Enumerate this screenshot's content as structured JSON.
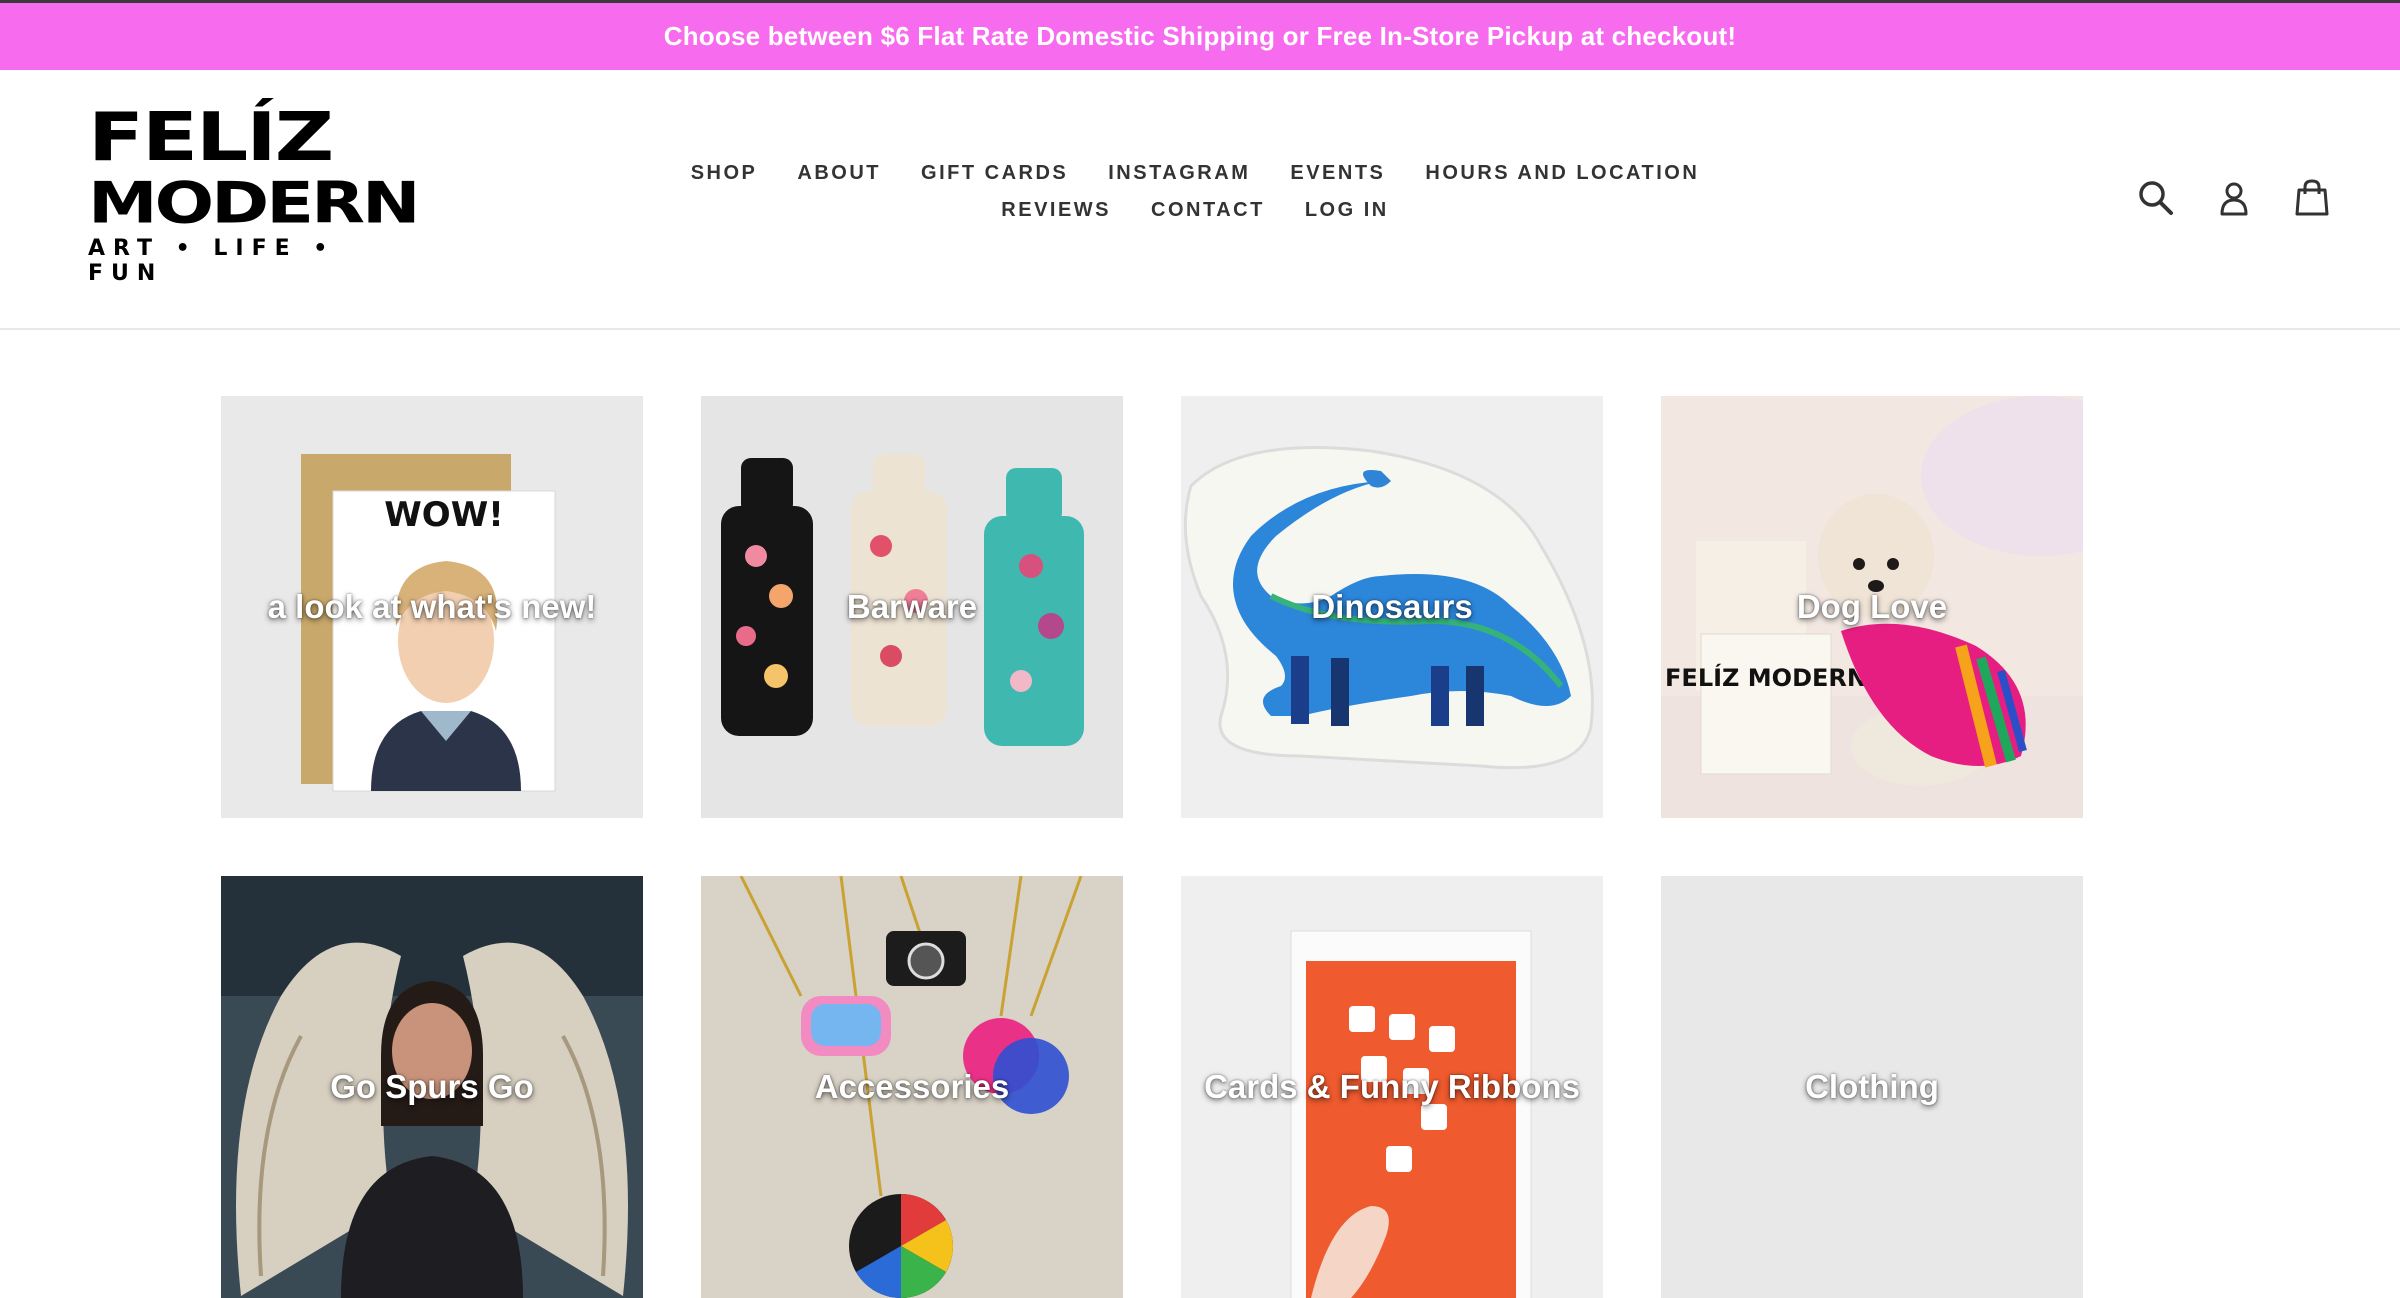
{
  "announcement": {
    "text": "Choose between $6 Flat Rate Domestic Shipping or Free In-Store Pickup at checkout!"
  },
  "logo": {
    "line1": "FELÍZ",
    "line2": "MODERN",
    "line3": "ART • LIFE • FUN"
  },
  "nav": {
    "row1": [
      "SHOP",
      "ABOUT",
      "GIFT CARDS",
      "INSTAGRAM",
      "EVENTS",
      "HOURS AND LOCATION"
    ],
    "row2": [
      "REVIEWS",
      "CONTACT",
      "LOG IN"
    ]
  },
  "header_icons": [
    "search-icon",
    "account-icon",
    "cart-icon"
  ],
  "collections": [
    {
      "label": "a look at what's new!"
    },
    {
      "label": "Barware"
    },
    {
      "label": "Dinosaurs"
    },
    {
      "label": "Dog Love"
    },
    {
      "label": "Go Spurs Go"
    },
    {
      "label": "Accessories"
    },
    {
      "label": "Cards & Funny Ribbons"
    },
    {
      "label": "Clothing"
    }
  ],
  "image_text": {
    "wow_card": "WOW!",
    "dog_box": "FELÍZ MODERN"
  },
  "colors": {
    "announcement_bg": "#f76cee",
    "text_dark": "#333333"
  }
}
